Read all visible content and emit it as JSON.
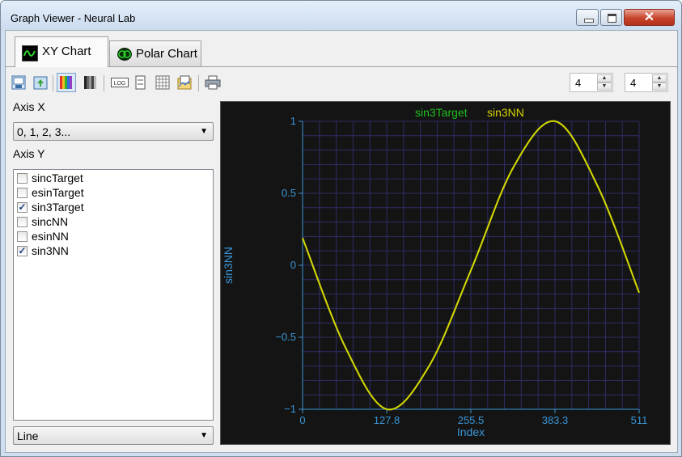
{
  "window": {
    "title": "Graph Viewer - Neural Lab",
    "close_glyph": "✕"
  },
  "tabs": [
    {
      "label": "XY Chart",
      "icon": "xy-chart-icon",
      "active": true
    },
    {
      "label": "Polar Chart",
      "icon": "polar-chart-icon",
      "active": false
    }
  ],
  "toolbar": {
    "icons": [
      "save-image-icon",
      "export-icon",
      "color-palette-icon",
      "grayscale-palette-icon",
      "log-scale-icon",
      "scale-icon",
      "grid-icon",
      "copy-icon",
      "print-icon"
    ],
    "log_label": "LOG",
    "spin1": {
      "value": "4"
    },
    "spin2": {
      "value": "4"
    }
  },
  "left_panel": {
    "axis_x_label": "Axis X",
    "axis_x_selected": "0, 1, 2, 3...",
    "axis_y_label": "Axis Y",
    "axis_y_items": [
      {
        "label": "sincTarget",
        "checked": false
      },
      {
        "label": "esinTarget",
        "checked": false
      },
      {
        "label": "sin3Target",
        "checked": true
      },
      {
        "label": "sincNN",
        "checked": false
      },
      {
        "label": "esinNN",
        "checked": false
      },
      {
        "label": "sin3NN",
        "checked": true
      }
    ],
    "check_glyph": "✓",
    "plot_type_selected": "Line"
  },
  "chart_data": {
    "type": "line",
    "xlabel": "Index",
    "ylabel": "sin3NN",
    "xlim": [
      0,
      511
    ],
    "ylim": [
      -1,
      1
    ],
    "x_ticks": [
      "0",
      "127.8",
      "255.5",
      "383.3",
      "511"
    ],
    "y_ticks": [
      "1",
      "0.5",
      "0",
      "−0.5",
      "−1"
    ],
    "grid": true,
    "legend_placement": "top-center",
    "series": [
      {
        "name": "sin3Target",
        "color": "#1fbf1f",
        "x": [
          0,
          64,
          128,
          192,
          256,
          320,
          384,
          448,
          511
        ],
        "y": [
          0.19,
          -0.56,
          -1.0,
          -0.7,
          -0.03,
          0.68,
          1.0,
          0.55,
          -0.19
        ]
      },
      {
        "name": "sin3NN",
        "color": "#d8d200",
        "x": [
          0,
          64,
          128,
          192,
          256,
          320,
          384,
          448,
          511
        ],
        "y": [
          0.19,
          -0.56,
          -1.0,
          -0.7,
          -0.03,
          0.68,
          1.0,
          0.55,
          -0.19
        ]
      }
    ],
    "colors": {
      "background": "#141414",
      "grid": "#2c2c66",
      "axis": "#3a96d8",
      "tick_text": "#3a96d8"
    }
  }
}
